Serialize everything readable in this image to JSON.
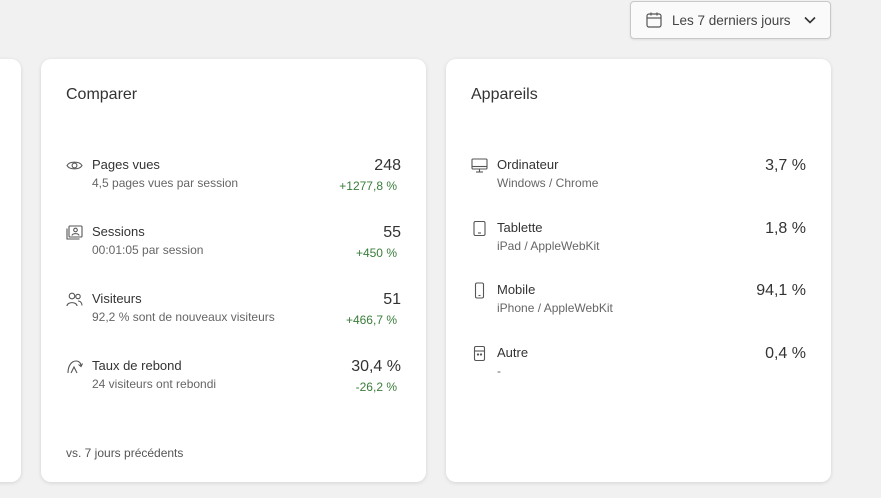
{
  "date_range": {
    "label": "Les 7 derniers jours"
  },
  "compare": {
    "title": "Comparer",
    "rows": [
      {
        "name": "Pages vues",
        "sub": "4,5 pages vues par session",
        "value": "248",
        "delta": "+1277,8 %",
        "icon": "eye-icon"
      },
      {
        "name": "Sessions",
        "sub": "00:01:05 par session",
        "value": "55",
        "delta": "+450 %",
        "icon": "session-icon"
      },
      {
        "name": "Visiteurs",
        "sub": "92,2 % sont de nouveaux visiteurs",
        "value": "51",
        "delta": "+466,7 %",
        "icon": "users-icon"
      },
      {
        "name": "Taux de rebond",
        "sub": "24 visiteurs ont rebondi",
        "value": "30,4 %",
        "delta": "-26,2 %",
        "icon": "bounce-icon"
      }
    ],
    "footer": "vs. 7 jours précédents"
  },
  "devices": {
    "title": "Appareils",
    "rows": [
      {
        "name": "Ordinateur",
        "sub": "Windows / Chrome",
        "value": "3,7 %",
        "icon": "desktop-icon"
      },
      {
        "name": "Tablette",
        "sub": "iPad / AppleWebKit",
        "value": "1,8 %",
        "icon": "tablet-icon"
      },
      {
        "name": "Mobile",
        "sub": "iPhone / AppleWebKit",
        "value": "94,1 %",
        "icon": "mobile-icon"
      },
      {
        "name": "Autre",
        "sub": "-",
        "value": "0,4 %",
        "icon": "other-device-icon"
      }
    ]
  },
  "colors": {
    "positive": "#3a7d3a",
    "card_bg": "#ffffff",
    "page_bg": "#f1f1f1"
  }
}
